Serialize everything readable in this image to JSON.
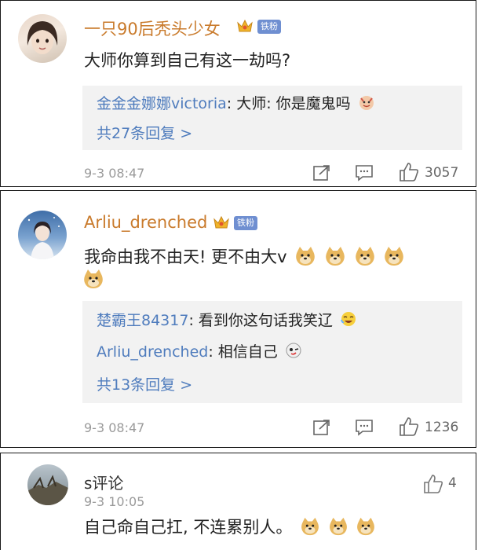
{
  "comments": [
    {
      "username": "一只90后秃头少女",
      "badge": "铁粉",
      "text": "大师你算到自己有这一劫吗?",
      "replies": [
        {
          "who": "金金金娜娜victoria",
          "text": ": 大师: 你是魔鬼吗"
        }
      ],
      "more": "共27条回复 >",
      "time": "9-3 08:47",
      "likes": "3057"
    },
    {
      "username": "Arliu_drenched",
      "badge": "铁粉",
      "text": "我命由我不由天! 更不由大v",
      "replies": [
        {
          "who": "楚霸王84317",
          "text": ": 看到你这句话我笑辽"
        },
        {
          "who": "Arliu_drenched",
          "text": ": 相信自己"
        }
      ],
      "more": "共13条回复 >",
      "time": "9-3 08:47",
      "likes": "1236"
    },
    {
      "username": "s评论",
      "time": "9-3 10:05",
      "text": "自己命自己扛, 不连累别人。",
      "likes": "4"
    }
  ],
  "colors": {
    "username_gold": "#c97a2b",
    "reply_link": "#4f7cbd",
    "badge": "#6f8fd1",
    "time_gray": "#9a9a9a"
  },
  "icons": [
    "crown-icon",
    "fans-badge",
    "share-icon",
    "comment-icon",
    "like-icon",
    "doge-emoji",
    "devil-emoji",
    "laugh-emoji",
    "wink-emoji"
  ]
}
